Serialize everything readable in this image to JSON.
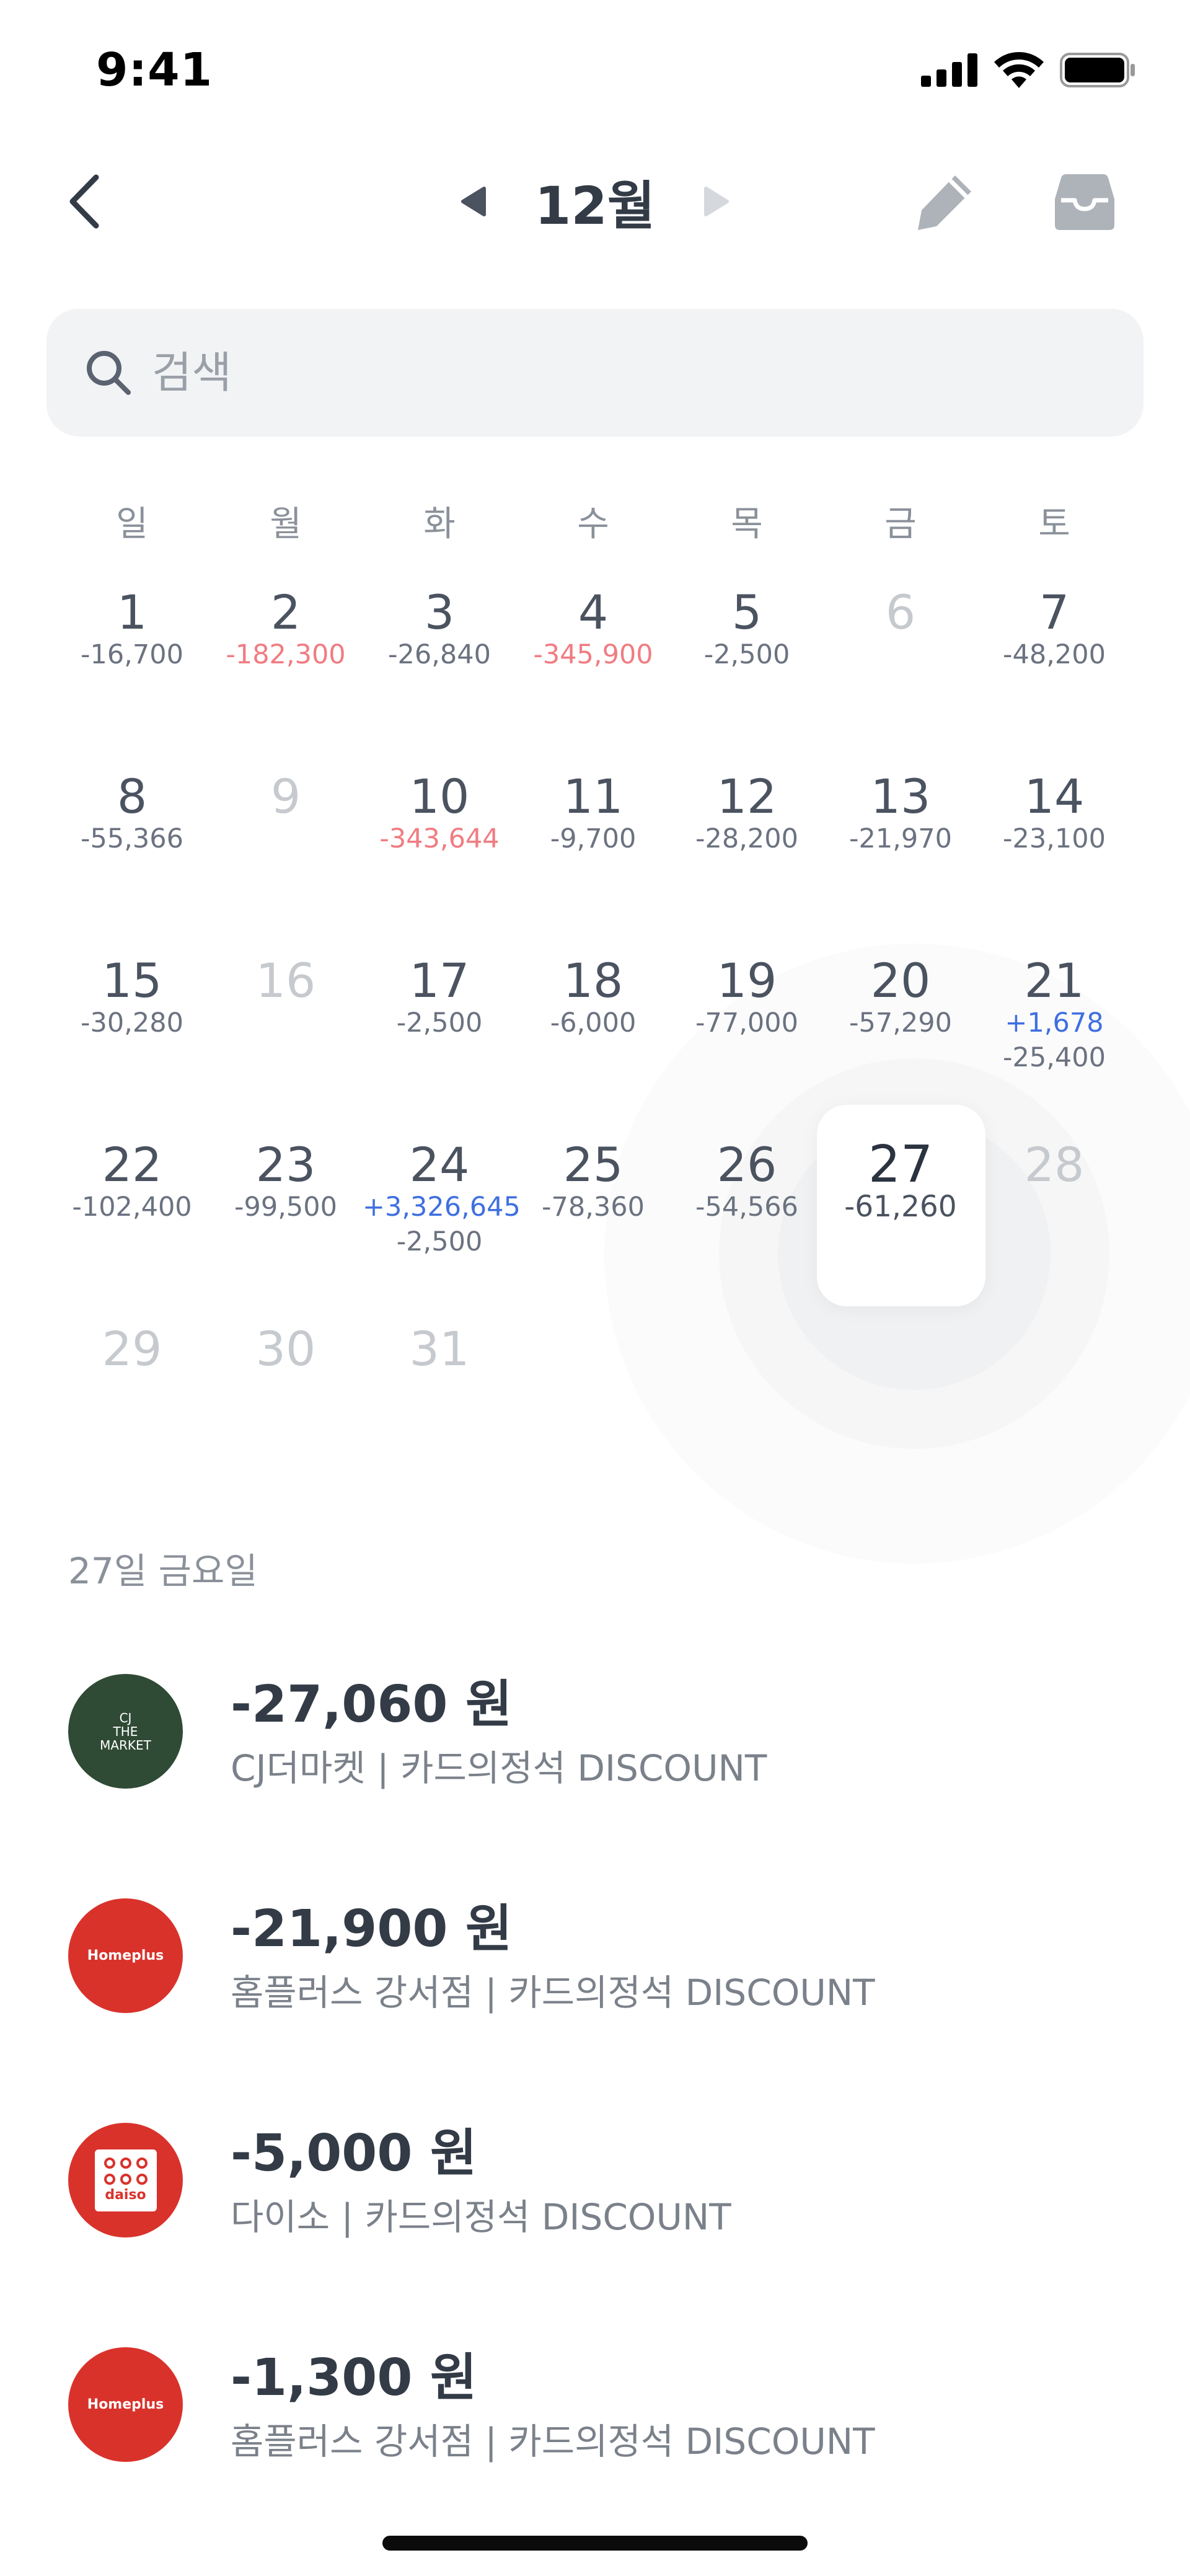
{
  "status_bar": {
    "time": "9:41"
  },
  "header": {
    "month": "12월"
  },
  "search": {
    "placeholder": "검색"
  },
  "weekdays": [
    "일",
    "월",
    "화",
    "수",
    "목",
    "금",
    "토"
  ],
  "calendar": {
    "days": [
      {
        "day": "1",
        "amounts": [
          {
            "text": "-16,700",
            "tone": "gray"
          }
        ]
      },
      {
        "day": "2",
        "amounts": [
          {
            "text": "-182,300",
            "tone": "red"
          }
        ]
      },
      {
        "day": "3",
        "amounts": [
          {
            "text": "-26,840",
            "tone": "gray"
          }
        ]
      },
      {
        "day": "4",
        "amounts": [
          {
            "text": "-345,900",
            "tone": "red"
          }
        ]
      },
      {
        "day": "5",
        "amounts": [
          {
            "text": "-2,500",
            "tone": "gray"
          }
        ]
      },
      {
        "day": "6",
        "amounts": [],
        "dim": true
      },
      {
        "day": "7",
        "amounts": [
          {
            "text": "-48,200",
            "tone": "gray"
          }
        ]
      },
      {
        "day": "8",
        "amounts": [
          {
            "text": "-55,366",
            "tone": "gray"
          }
        ]
      },
      {
        "day": "9",
        "amounts": [],
        "dim": true
      },
      {
        "day": "10",
        "amounts": [
          {
            "text": "-343,644",
            "tone": "red"
          }
        ]
      },
      {
        "day": "11",
        "amounts": [
          {
            "text": "-9,700",
            "tone": "gray"
          }
        ]
      },
      {
        "day": "12",
        "amounts": [
          {
            "text": "-28,200",
            "tone": "gray"
          }
        ]
      },
      {
        "day": "13",
        "amounts": [
          {
            "text": "-21,970",
            "tone": "gray"
          }
        ]
      },
      {
        "day": "14",
        "amounts": [
          {
            "text": "-23,100",
            "tone": "gray"
          }
        ]
      },
      {
        "day": "15",
        "amounts": [
          {
            "text": "-30,280",
            "tone": "gray"
          }
        ]
      },
      {
        "day": "16",
        "amounts": [],
        "dim": true
      },
      {
        "day": "17",
        "amounts": [
          {
            "text": "-2,500",
            "tone": "gray"
          }
        ]
      },
      {
        "day": "18",
        "amounts": [
          {
            "text": "-6,000",
            "tone": "gray"
          }
        ]
      },
      {
        "day": "19",
        "amounts": [
          {
            "text": "-77,000",
            "tone": "gray"
          }
        ]
      },
      {
        "day": "20",
        "amounts": [
          {
            "text": "-57,290",
            "tone": "gray"
          }
        ]
      },
      {
        "day": "21",
        "amounts": [
          {
            "text": "+1,678",
            "tone": "blue"
          },
          {
            "text": "-25,400",
            "tone": "gray"
          }
        ]
      },
      {
        "day": "22",
        "amounts": [
          {
            "text": "-102,400",
            "tone": "gray"
          }
        ]
      },
      {
        "day": "23",
        "amounts": [
          {
            "text": "-99,500",
            "tone": "gray"
          }
        ]
      },
      {
        "day": "24",
        "amounts": [
          {
            "text": "+3,326,645",
            "tone": "blue"
          },
          {
            "text": "-2,500",
            "tone": "gray"
          }
        ]
      },
      {
        "day": "25",
        "amounts": [
          {
            "text": "-78,360",
            "tone": "gray"
          }
        ]
      },
      {
        "day": "26",
        "amounts": [
          {
            "text": "-54,566",
            "tone": "gray"
          }
        ]
      },
      {
        "day": "27",
        "amounts": [
          {
            "text": "-61,260",
            "tone": "gray"
          }
        ],
        "selected": true
      },
      {
        "day": "28",
        "amounts": [],
        "dim": true
      },
      {
        "day": "29",
        "amounts": [],
        "dim": true
      },
      {
        "day": "30",
        "amounts": [],
        "dim": true
      },
      {
        "day": "31",
        "amounts": [],
        "dim": true
      }
    ]
  },
  "selected_date_label": "27일 금요일",
  "transactions": [
    {
      "amount": "-27,060 원",
      "description": "CJ더마켓 | 카드의정석 DISCOUNT",
      "logo": "cj-the-market",
      "logo_text": [
        "CJ",
        "THE",
        "MARKET"
      ]
    },
    {
      "amount": "-21,900 원",
      "description": "홈플러스 강서점 | 카드의정석 DISCOUNT",
      "logo": "homeplus",
      "logo_text": [
        "Homeplus"
      ]
    },
    {
      "amount": "-5,000 원",
      "description": "다이소 | 카드의정석 DISCOUNT",
      "logo": "daiso",
      "logo_text": [
        "daiso"
      ]
    },
    {
      "amount": "-1,300 원",
      "description": "홈플러스 강서점 | 카드의정석 DISCOUNT",
      "logo": "homeplus",
      "logo_text": [
        "Homeplus"
      ]
    }
  ],
  "colors": {
    "text_primary": "#333b46",
    "text_secondary": "#7b818a",
    "expense_large": "#f07c82",
    "income": "#3f6fe0",
    "brand_red": "#d9322b",
    "cj_green": "#2f4a35"
  }
}
